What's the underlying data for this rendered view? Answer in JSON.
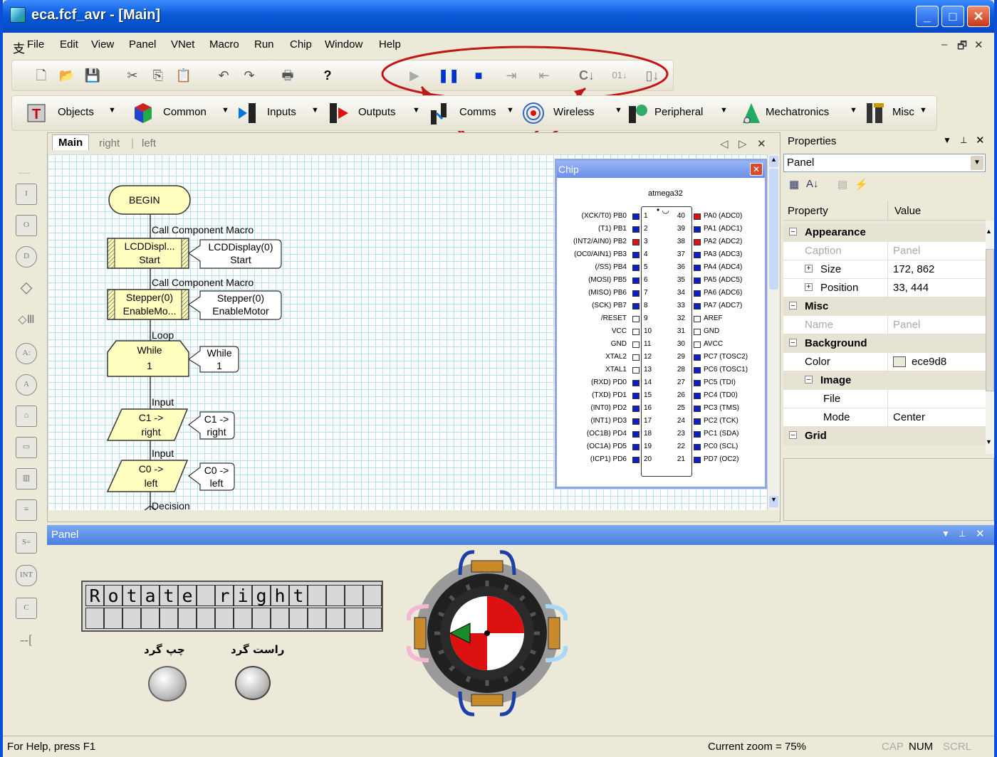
{
  "window": {
    "title": "eca.fcf_avr - [Main]"
  },
  "menu": [
    "File",
    "Edit",
    "View",
    "Panel",
    "VNet",
    "Macro",
    "Run",
    "Chip",
    "Window",
    "Help"
  ],
  "toolbar2": [
    "Objects",
    "Common",
    "Inputs",
    "Outputs",
    "Comms",
    "Wireless",
    "Peripheral",
    "Mechatronics",
    "Misc"
  ],
  "doc_tabs": [
    "Main",
    "right",
    "left"
  ],
  "flowchart": {
    "begin": "BEGIN",
    "call1_label": "Call Component Macro",
    "call1_text": [
      "LCDDispl...",
      "Start"
    ],
    "call1_note": [
      "LCDDisplay(0)",
      "Start"
    ],
    "call2_label": "Call Component Macro",
    "call2_text": [
      "Stepper(0)",
      "EnableMo..."
    ],
    "call2_note": [
      "Stepper(0)",
      "EnableMotor"
    ],
    "loop_label": "Loop",
    "loop_text": [
      "While",
      "1"
    ],
    "loop_note": [
      "While",
      "1"
    ],
    "input1_label": "Input",
    "input1_text": [
      "C1 ->",
      "right"
    ],
    "input1_note": [
      "C1 ->",
      "right"
    ],
    "input2_label": "Input",
    "input2_text": [
      "C0 ->",
      "left"
    ],
    "input2_note": [
      "C0 ->",
      "left"
    ],
    "decision_label": "Decision"
  },
  "chip": {
    "title": "Chip",
    "name": "atmega32",
    "left_pins": [
      "(XCK/T0) PB0",
      "(T1) PB1",
      "(INT2/AIN0) PB2",
      "(OC0/AIN1) PB3",
      "(/SS) PB4",
      "(MOSI) PB5",
      "(MISO) PB6",
      "(SCK) PB7",
      "/RESET",
      "VCC",
      "GND",
      "XTAL2",
      "XTAL1",
      "(RXD) PD0",
      "(TXD) PD1",
      "(INT0) PD2",
      "(INT1) PD3",
      "(OC1B) PD4",
      "(OC1A) PD5",
      "(ICP1) PD6"
    ],
    "right_pins": [
      "PA0 (ADC0)",
      "PA1 (ADC1)",
      "PA2 (ADC2)",
      "PA3 (ADC3)",
      "PA4 (ADC4)",
      "PA5 (ADC5)",
      "PA6 (ADC6)",
      "PA7 (ADC7)",
      "AREF",
      "GND",
      "AVCC",
      "PC7 (TOSC2)",
      "PC6 (TOSC1)",
      "PC5 (TDI)",
      "PC4 (TD0)",
      "PC3 (TMS)",
      "PC2 (TCK)",
      "PC1 (SDA)",
      "PC0 (SCL)",
      "PD7 (OC2)"
    ],
    "left_nums": [
      "1",
      "2",
      "3",
      "4",
      "5",
      "6",
      "7",
      "8",
      "9",
      "10",
      "11",
      "12",
      "13",
      "14",
      "15",
      "16",
      "17",
      "18",
      "19",
      "20"
    ],
    "right_nums": [
      "40",
      "39",
      "38",
      "37",
      "36",
      "35",
      "34",
      "33",
      "32",
      "31",
      "30",
      "29",
      "28",
      "27",
      "26",
      "25",
      "24",
      "23",
      "22",
      "21"
    ],
    "red_left": [
      2
    ],
    "red_right": [
      0,
      2
    ]
  },
  "properties": {
    "title": "Properties",
    "object": "Panel",
    "col_property": "Property",
    "col_value": "Value",
    "rows": [
      {
        "k": "Appearance",
        "v": "",
        "kind": "group"
      },
      {
        "k": "Caption",
        "v": "Panel",
        "kind": "disabled"
      },
      {
        "k": "Size",
        "v": "172, 862",
        "kind": "expand"
      },
      {
        "k": "Position",
        "v": "33, 444",
        "kind": "expand"
      },
      {
        "k": "Misc",
        "v": "",
        "kind": "group"
      },
      {
        "k": "Name",
        "v": "Panel",
        "kind": "disabled"
      },
      {
        "k": "Background",
        "v": "",
        "kind": "group"
      },
      {
        "k": "Color",
        "v": "ece9d8",
        "kind": "color"
      },
      {
        "k": "Image",
        "v": "",
        "kind": "subgroup"
      },
      {
        "k": "File",
        "v": "",
        "kind": "sub"
      },
      {
        "k": "Mode",
        "v": "Center",
        "kind": "sub"
      },
      {
        "k": "Grid",
        "v": "",
        "kind": "group"
      }
    ]
  },
  "panel": {
    "title": "Panel",
    "lcd_row1": [
      "R",
      "o",
      "t",
      "a",
      "t",
      "e",
      " ",
      "r",
      "i",
      "g",
      "h",
      "t",
      " ",
      " ",
      " ",
      " "
    ],
    "btn_left_label": "چپ گرد",
    "btn_right_label": "راست گرد"
  },
  "status": {
    "help": "For Help, press F1",
    "zoom": "Current zoom = 75%",
    "cap": "CAP",
    "num": "NUM",
    "scrl": "SCRL"
  },
  "colors": {
    "accent": "#0a5ad8",
    "run": "#0033cc",
    "annotation": "#c01818"
  }
}
